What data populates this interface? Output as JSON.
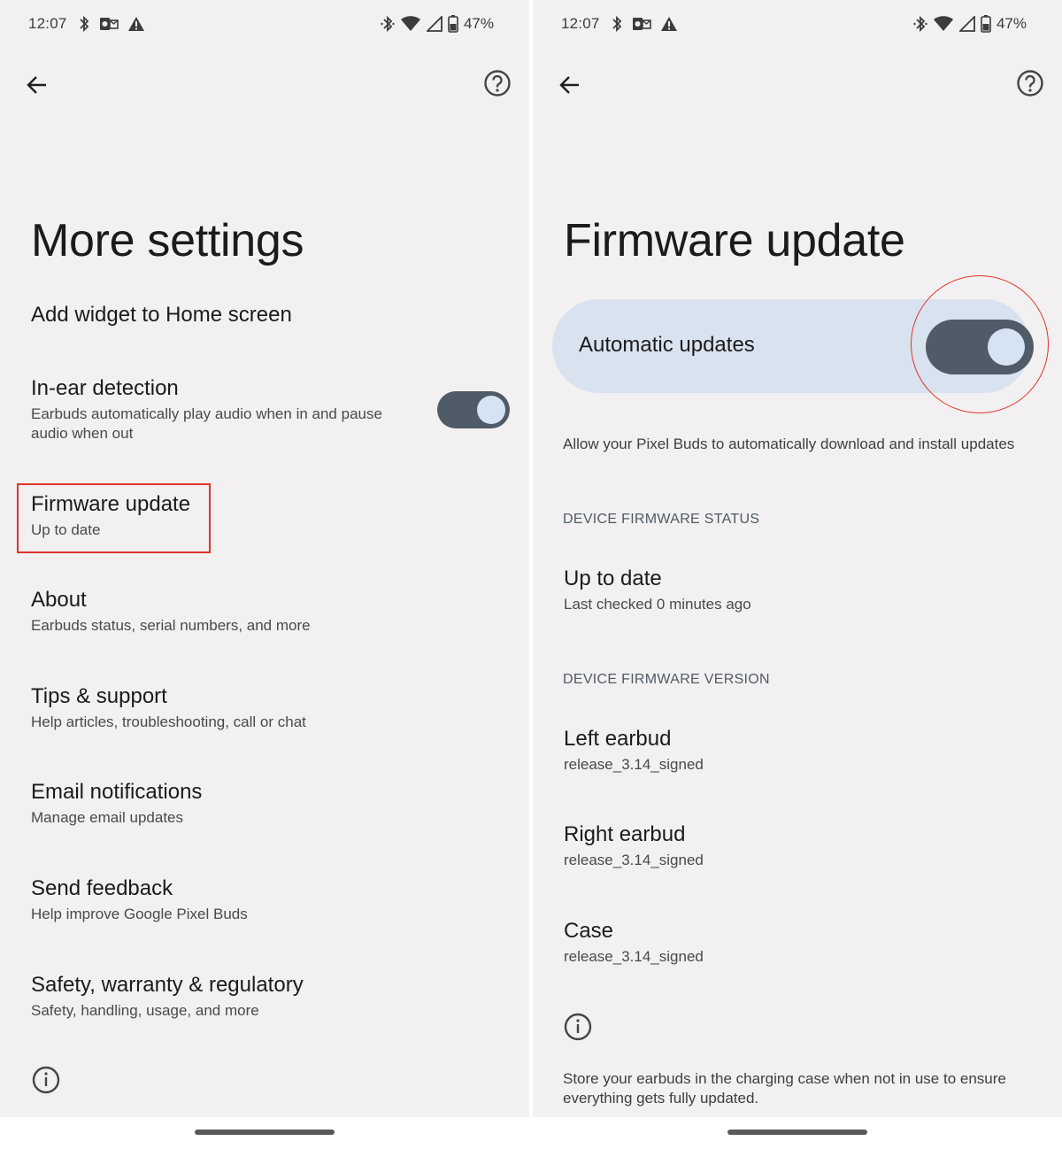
{
  "status_bar": {
    "time": "12:07",
    "battery": "47%"
  },
  "left": {
    "title": "More settings",
    "items": [
      {
        "title": "Add widget to Home screen"
      },
      {
        "title": "In-ear detection",
        "subtitle": "Earbuds automatically play audio when in and pause audio when out",
        "toggle_on": true
      },
      {
        "title": "Firmware update",
        "subtitle": "Up to date",
        "highlighted": true
      },
      {
        "title": "About",
        "subtitle": "Earbuds status, serial numbers, and more"
      },
      {
        "title": "Tips & support",
        "subtitle": "Help articles, troubleshooting, call or chat"
      },
      {
        "title": "Email notifications",
        "subtitle": "Manage email updates"
      },
      {
        "title": "Send feedback",
        "subtitle": "Help improve Google Pixel Buds"
      },
      {
        "title": "Safety, warranty & regulatory",
        "subtitle": "Safety, handling, usage, and more"
      }
    ]
  },
  "right": {
    "title": "Firmware update",
    "auto_updates": {
      "label": "Automatic updates",
      "on": true,
      "description": "Allow your Pixel Buds to automatically download and install updates"
    },
    "status_section": {
      "header": "DEVICE FIRMWARE STATUS",
      "title": "Up to date",
      "subtitle": "Last checked 0 minutes ago"
    },
    "version_section": {
      "header": "DEVICE FIRMWARE VERSION",
      "items": [
        {
          "title": "Left earbud",
          "subtitle": "release_3.14_signed"
        },
        {
          "title": "Right earbud",
          "subtitle": "release_3.14_signed"
        },
        {
          "title": "Case",
          "subtitle": "release_3.14_signed"
        }
      ]
    },
    "note": "Store your earbuds in the charging case when not in use to ensure everything gets fully updated."
  },
  "colors": {
    "background": "#f2f0f0",
    "toggle_track": "#4f5b67",
    "toggle_knob": "#d6e3f4",
    "card": "#d9e2ef",
    "annotation_red": "#e0332b"
  }
}
